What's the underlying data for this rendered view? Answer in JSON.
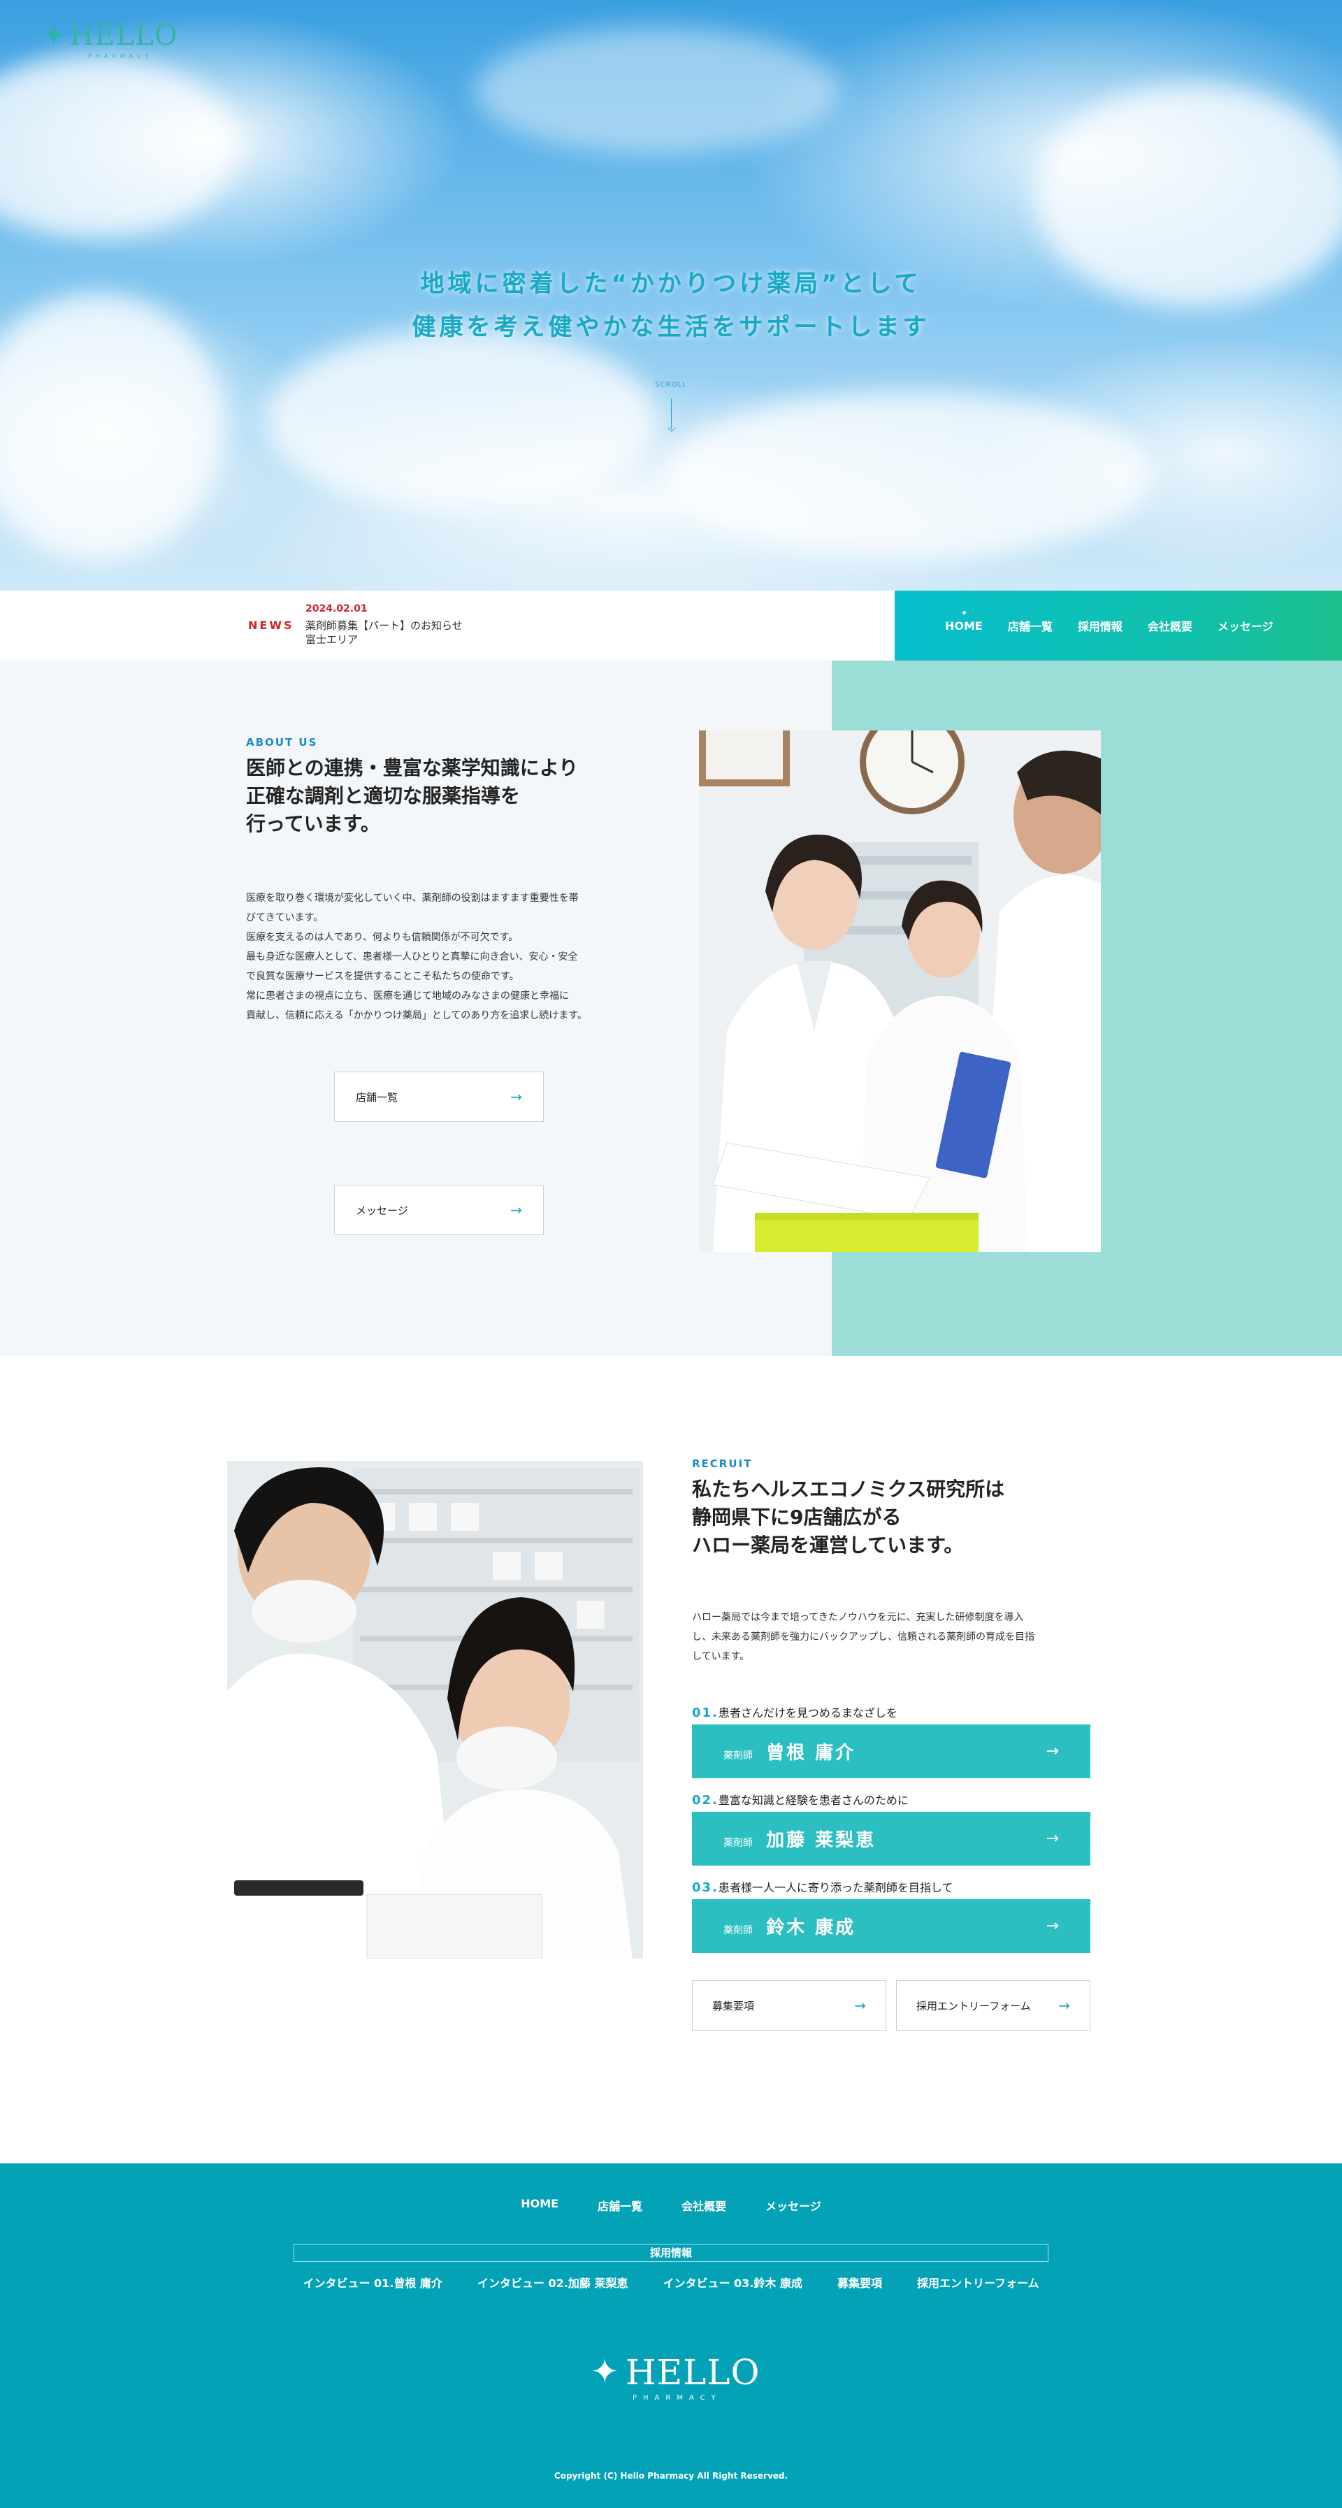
{
  "header": {
    "logo_text": "HELLO",
    "logo_sub": "PHARMACY"
  },
  "hero": {
    "line1": "地域に密着した“かかりつけ薬局”として",
    "line2": "健康を考え健やかな生活をサポートします",
    "scroll_label": "SCROLL"
  },
  "news": {
    "label": "NEWS",
    "date": "2024.02.01",
    "title": "薬剤師募集【パート】のお知らせ",
    "area": "富士エリア"
  },
  "nav": {
    "items": [
      {
        "label": "HOME"
      },
      {
        "label": "店舗一覧"
      },
      {
        "label": "採用情報"
      },
      {
        "label": "会社概要"
      },
      {
        "label": "メッセージ"
      }
    ]
  },
  "about": {
    "eyebrow": "ABOUT US",
    "heading_lines": [
      "医師との連携・豊富な薬学知識により",
      "正確な調剤と適切な服薬指導を",
      "行っています。"
    ],
    "body_lines": [
      "医療を取り巻く環境が変化していく中、薬剤師の役割はますます重要性を帯",
      "びてきています。",
      "医療を支えるのは人であり、何よりも信頼関係が不可欠です。",
      "最も身近な医療人として、患者様一人ひとりと真摯に向き合い、安心・安全",
      "で良質な医療サービスを提供することこそ私たちの使命です。",
      "常に患者さまの視点に立ち、医療を通じて地域のみなさまの健康と幸福に",
      "貢献し、信頼に応える「かかりつけ薬局」としてのあり方を追求し続けます。"
    ],
    "btn_stores": "店舗一覧",
    "btn_message": "メッセージ"
  },
  "recruit": {
    "eyebrow": "RECRUIT",
    "heading_lines": [
      "私たちヘルスエコノミクス研究所は",
      "静岡県下に9店舗広がる",
      "ハロー薬局を運営しています。"
    ],
    "body_lines": [
      "ハロー薬局では今まで培ってきたノウハウを元に、充実した研修制度を導入",
      "し、未来ある薬剤師を強力にバックアップし、信頼される薬剤師の育成を目指",
      "しています。"
    ],
    "staff": [
      {
        "num": "01.",
        "caption": "患者さんだけを見つめるまなざしを",
        "role": "薬剤師",
        "name": "曾根 庸介"
      },
      {
        "num": "02.",
        "caption": "豊富な知識と経験を患者さんのために",
        "role": "薬剤師",
        "name": "加藤 莱梨恵"
      },
      {
        "num": "03.",
        "caption": "患者様一人一人に寄り添った薬剤師を目指して",
        "role": "薬剤師",
        "name": "鈴木 康成"
      }
    ],
    "btn_requirements": "募集要項",
    "btn_entry": "採用エントリーフォーム"
  },
  "footer": {
    "nav1": [
      "HOME",
      "店舗一覧",
      "会社概要",
      "メッセージ"
    ],
    "group_label": "採用情報",
    "nav2": [
      "インタビュー 01.曾根 庸介",
      "インタビュー 02.加藤 莱梨恵",
      "インタビュー 03.鈴木 康成",
      "募集要項",
      "採用エントリーフォーム"
    ],
    "logo_text": "HELLO",
    "logo_sub": "PHARMACY",
    "copyright": "Copyright (C) Hello Pharmacy All Right Reserved."
  },
  "colors": {
    "accent": "#19a7c8",
    "news_red": "#d0262b",
    "mint": "#9bded7",
    "staff_bar": "#2cbfc2",
    "footer": "#04a2b6"
  },
  "icons": {
    "arrow": "→",
    "logo_mark": "figure-icon"
  }
}
